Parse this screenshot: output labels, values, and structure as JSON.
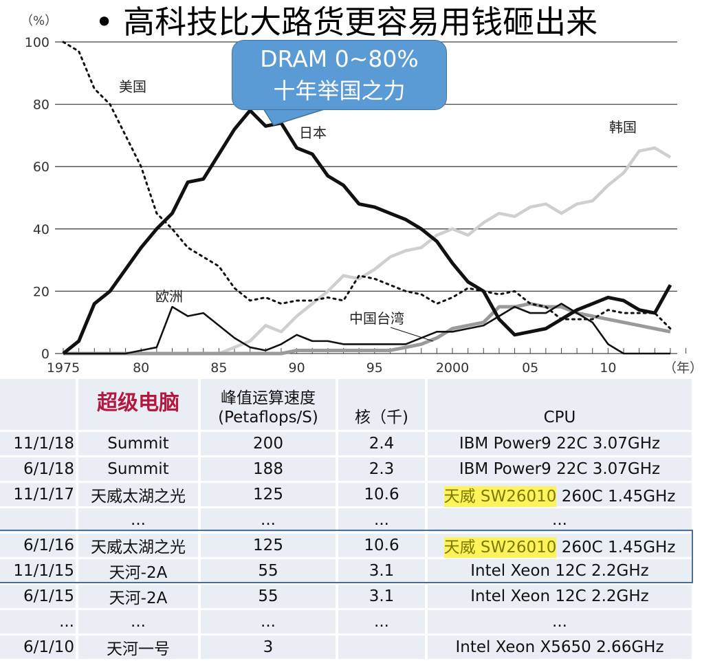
{
  "slide_title": "高科技比大路货更容易用钱砸出来",
  "callout": {
    "line1": "DRAM 0~80%",
    "line2": "十年举国之力",
    "color": "#5b9bd5"
  },
  "chart_data": {
    "type": "line",
    "title": "",
    "ylabel": "（%）",
    "xlabel": "（年）",
    "ylim": [
      0,
      100
    ],
    "xlim": [
      1975,
      2014.5
    ],
    "yticks": [
      0,
      20,
      40,
      60,
      80,
      100
    ],
    "xticks": [
      1975,
      1980,
      1985,
      1990,
      1995,
      2000,
      2005,
      2010
    ],
    "xtick_labels": [
      "1975",
      "80",
      "85",
      "90",
      "95",
      "2000",
      "05",
      "10"
    ],
    "grid": "horizontal",
    "series": [
      {
        "name": "美国",
        "style": "dotted",
        "color": "#111111",
        "x": [
          1975,
          1976,
          1977,
          1978,
          1979,
          1980,
          1981,
          1982,
          1983,
          1984,
          1985,
          1986,
          1987,
          1988,
          1989,
          1990,
          1991,
          1992,
          1993,
          1994,
          1995,
          1996,
          1997,
          1998,
          1999,
          2000,
          2001,
          2002,
          2003,
          2004,
          2005,
          2006,
          2007,
          2008,
          2009,
          2010,
          2011,
          2012,
          2013,
          2014
        ],
        "values": [
          100,
          97,
          85,
          80,
          70,
          60,
          45,
          40,
          34,
          31,
          28,
          21,
          17,
          18,
          16,
          17,
          17,
          18,
          17,
          25,
          24,
          22,
          20,
          19,
          16,
          18,
          21,
          20,
          19,
          20,
          16,
          15,
          11,
          11,
          11,
          14,
          13,
          13,
          13,
          8
        ]
      },
      {
        "name": "日本",
        "style": "thick",
        "color": "#111111",
        "x": [
          1975,
          1976,
          1977,
          1978,
          1979,
          1980,
          1981,
          1982,
          1983,
          1984,
          1985,
          1986,
          1987,
          1988,
          1989,
          1990,
          1991,
          1992,
          1993,
          1994,
          1995,
          1996,
          1997,
          1998,
          1999,
          2000,
          2001,
          2002,
          2003,
          2004,
          2005,
          2006,
          2007,
          2008,
          2009,
          2010,
          2011,
          2012,
          2013,
          2014
        ],
        "values": [
          0,
          4,
          16,
          20,
          27,
          34,
          40,
          45,
          55,
          56,
          64,
          72,
          78,
          73,
          74,
          66,
          64,
          57,
          54,
          48,
          47,
          45,
          43,
          40,
          36,
          29,
          23,
          20,
          11,
          6,
          7,
          8,
          11,
          14,
          16,
          18,
          17,
          14,
          13,
          22
        ]
      },
      {
        "name": "韩国",
        "style": "light",
        "color": "#cccccc",
        "x": [
          1985,
          1986,
          1987,
          1988,
          1989,
          1990,
          1991,
          1992,
          1993,
          1994,
          1995,
          1996,
          1997,
          1998,
          1999,
          2000,
          2001,
          2002,
          2003,
          2004,
          2005,
          2006,
          2007,
          2008,
          2009,
          2010,
          2011,
          2012,
          2013,
          2014
        ],
        "values": [
          0,
          2,
          4,
          9,
          7,
          12,
          16,
          20,
          25,
          24,
          27,
          31,
          33,
          34,
          38,
          40,
          38,
          42,
          45,
          44,
          47,
          48,
          45,
          48,
          49,
          54,
          58,
          65,
          66,
          63
        ]
      },
      {
        "name": "欧洲",
        "style": "medium",
        "color": "#111111",
        "x": [
          1975,
          1979,
          1980,
          1981,
          1982,
          1983,
          1984,
          1985,
          1986,
          1987,
          1988,
          1989,
          1990,
          1991,
          1992,
          1993,
          1994,
          1995,
          1996,
          1997,
          1998,
          1999,
          2000,
          2001,
          2002,
          2003,
          2004,
          2005,
          2006,
          2007,
          2008,
          2009,
          2010,
          2011,
          2012,
          2013,
          2014
        ],
        "values": [
          0,
          0,
          1,
          2,
          15,
          12,
          13,
          9,
          5,
          2,
          1,
          3,
          6,
          4,
          4,
          3,
          3,
          3,
          3,
          3,
          5,
          7,
          7,
          8,
          9,
          12,
          15,
          13,
          13,
          16,
          13,
          10,
          3,
          0,
          0,
          0,
          0
        ]
      },
      {
        "name": "中国台湾",
        "style": "medium-gray",
        "color": "#999999",
        "x": [
          1975,
          1989,
          1990,
          1991,
          1992,
          1993,
          1994,
          1995,
          1996,
          1997,
          1998,
          1999,
          2000,
          2001,
          2002,
          2003,
          2004,
          2005,
          2006,
          2007,
          2008,
          2009,
          2010,
          2011,
          2012,
          2013,
          2014
        ],
        "values": [
          0,
          0,
          1,
          1,
          1,
          1,
          1,
          1,
          1,
          2,
          3,
          5,
          8,
          9,
          10,
          15,
          15,
          16,
          15,
          15,
          13,
          12,
          11,
          10,
          9,
          8,
          7
        ]
      }
    ],
    "labels": [
      {
        "text": "美国"
      },
      {
        "text": "日本"
      },
      {
        "text": "韩国"
      },
      {
        "text": "欧洲"
      },
      {
        "text": "中国台湾"
      }
    ]
  },
  "table": {
    "headers": {
      "date": "",
      "name": "超级电脑",
      "peak_line1": "峰值运算速度",
      "peak_line2": "(Petaflops/S)",
      "cores": "核（千)",
      "cpu": "CPU"
    },
    "rows": [
      {
        "date": "11/1/18",
        "name": "Summit",
        "peak": "200",
        "cores": "2.4",
        "cpu_hl": "",
        "cpu": "IBM Power9 22C 3.07GHz"
      },
      {
        "date": "6/1/18",
        "name": "Summit",
        "peak": "188",
        "cores": "2.3",
        "cpu_hl": "",
        "cpu": "IBM Power9 22C 3.07GHz"
      },
      {
        "date": "11/1/17",
        "name": "天威太湖之光",
        "peak": "125",
        "cores": "10.6",
        "cpu_hl": "天威 SW26010",
        "cpu": " 260C 1.45GHz"
      },
      {
        "date": "",
        "name": "...",
        "peak": "...",
        "cores": "...",
        "cpu_hl": "",
        "cpu": "..."
      },
      {
        "date": "6/1/16",
        "name": "天威太湖之光",
        "peak": "125",
        "cores": "10.6",
        "cpu_hl": "天威 SW26010",
        "cpu": " 260C 1.45GHz"
      },
      {
        "date": "11/1/15",
        "name": "天河-2A",
        "peak": "55",
        "cores": "3.1",
        "cpu_hl": "",
        "cpu": "Intel Xeon 12C 2.2GHz"
      },
      {
        "date": "6/1/15",
        "name": "天河-2A",
        "peak": "55",
        "cores": "3.1",
        "cpu_hl": "",
        "cpu": "Intel Xeon 12C 2.2GHz"
      },
      {
        "date": "...",
        "name": "...",
        "peak": "...",
        "cores": "...",
        "cpu_hl": "",
        "cpu": "..."
      },
      {
        "date": "6/1/10",
        "name": "天河一号",
        "peak": "3",
        "cores": "",
        "cpu_hl": "",
        "cpu": "Intel Xeon X5650 2.66GHz"
      }
    ]
  }
}
